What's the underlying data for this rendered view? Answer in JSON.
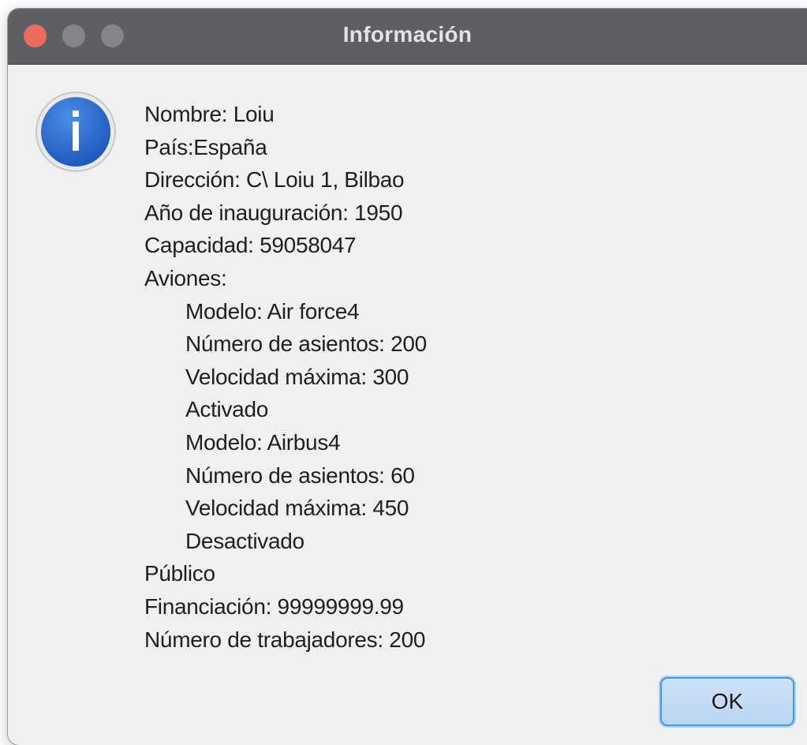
{
  "window": {
    "title": "Información"
  },
  "icons": {
    "info": "info-icon"
  },
  "message": {
    "lines": [
      "Nombre: Loiu",
      "País:España",
      "Dirección: C\\ Loiu 1, Bilbao",
      "Año de inauguración: 1950",
      "Capacidad: 59058047",
      "Aviones:",
      "Modelo: Air force4",
      "Número de asientos: 200",
      "Velocidad máxima: 300",
      "Activado",
      "Modelo: Airbus4",
      "Número de asientos: 60",
      "Velocidad máxima: 450",
      "Desactivado",
      "Público",
      "Financiación: 99999999.99",
      "Número de trabajadores: 200"
    ]
  },
  "buttons": {
    "ok_label": "OK"
  },
  "colors": {
    "titlebar": "#5f5e63",
    "close": "#ed6a5e",
    "inactive_control": "#858488",
    "info_blue": "#2f6fd0",
    "ok_border": "#3f9be6"
  }
}
